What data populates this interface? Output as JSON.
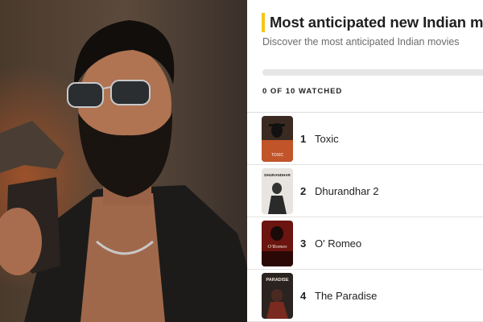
{
  "page": {
    "title": "Most anticipated new Indian m",
    "subtitle": "Discover the most anticipated Indian movies",
    "accent_color": "#f5c518"
  },
  "progress": {
    "watched_label": "0 OF 10 WATCHED",
    "fraction": 0
  },
  "hero_image": {
    "description_icon": "hero-photo"
  },
  "movies": [
    {
      "rank": "1",
      "title": "Toxic",
      "poster_text": "TOXIC"
    },
    {
      "rank": "2",
      "title": "Dhurandhar 2",
      "poster_text": "DHURANDHAR"
    },
    {
      "rank": "3",
      "title": "O' Romeo",
      "poster_text": "O'Romeo"
    },
    {
      "rank": "4",
      "title": "The Paradise",
      "poster_text": "PARADISE"
    }
  ]
}
